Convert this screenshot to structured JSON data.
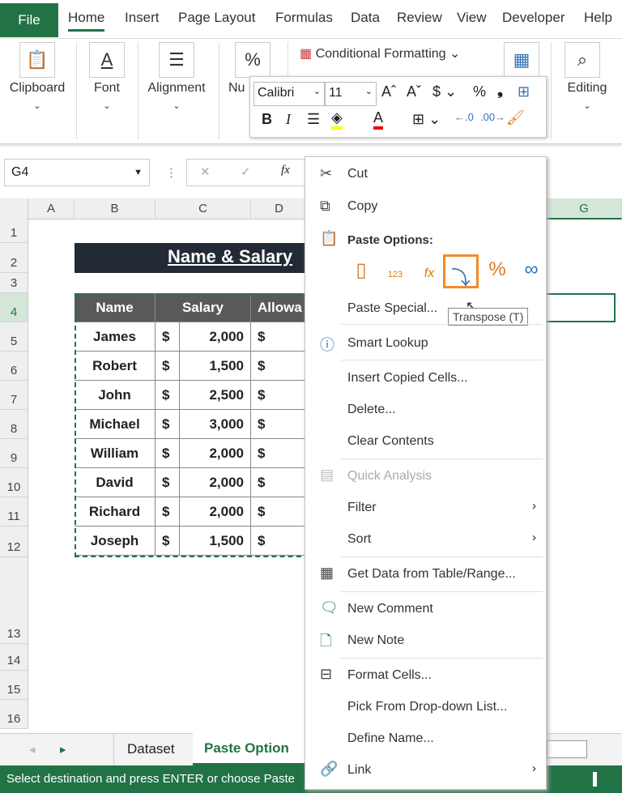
{
  "ribbon_tabs": [
    "File",
    "Home",
    "Insert",
    "Page Layout",
    "Formulas",
    "Data",
    "Review",
    "View",
    "Developer",
    "Help"
  ],
  "groups": {
    "clipboard": "Clipboard",
    "font": "Font",
    "alignment": "Alignment",
    "number": "Nu",
    "editing": "Editing",
    "conditional": "Conditional Formatting"
  },
  "mini": {
    "font": "Calibri",
    "size": "11"
  },
  "name_box": "G4",
  "columns": [
    "A",
    "B",
    "C",
    "D",
    "G"
  ],
  "rows": [
    "1",
    "2",
    "3",
    "4",
    "5",
    "6",
    "7",
    "8",
    "9",
    "10",
    "11",
    "12",
    "13",
    "14",
    "15",
    "16"
  ],
  "table": {
    "title": "Name & Salary",
    "headers": [
      "Name",
      "Salary",
      "Allowa"
    ],
    "rows": [
      [
        "James",
        "$",
        "2,000",
        "$"
      ],
      [
        "Robert",
        "$",
        "1,500",
        "$"
      ],
      [
        "John",
        "$",
        "2,500",
        "$"
      ],
      [
        "Michael",
        "$",
        "3,000",
        "$"
      ],
      [
        "William",
        "$",
        "2,000",
        "$"
      ],
      [
        "David",
        "$",
        "2,000",
        "$"
      ],
      [
        "Richard",
        "$",
        "2,000",
        "$"
      ],
      [
        "Joseph",
        "$",
        "1,500",
        "$"
      ]
    ]
  },
  "menu": {
    "cut": "Cut",
    "copy": "Copy",
    "paste_options": "Paste Options:",
    "paste_special": "Paste Special...",
    "tooltip": "Transpose (T)",
    "smart_lookup": "Smart Lookup",
    "insert_copied": "Insert Copied Cells...",
    "delete": "Delete...",
    "clear": "Clear Contents",
    "quick_analysis": "Quick Analysis",
    "filter": "Filter",
    "sort": "Sort",
    "get_data": "Get Data from Table/Range...",
    "new_comment": "New Comment",
    "new_note": "New Note",
    "format_cells": "Format Cells...",
    "pick_list": "Pick From Drop-down List...",
    "define_name": "Define Name...",
    "link": "Link"
  },
  "sheets": [
    "Dataset",
    "Paste Option"
  ],
  "status": "Select destination and press ENTER or choose Paste",
  "colors": {
    "excel_green": "#217346",
    "header_dark": "#595959",
    "title_bg": "#222b35",
    "highlight": "#f28c28"
  }
}
